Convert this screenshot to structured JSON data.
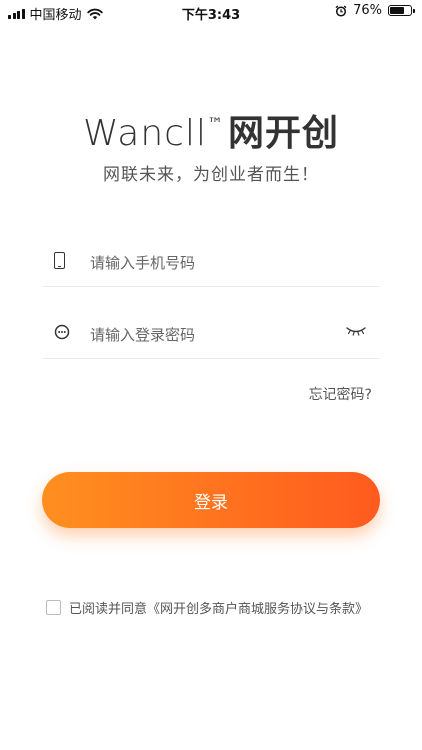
{
  "status_bar": {
    "carrier": "中国移动",
    "time": "下午3:43",
    "battery_percent": "76%",
    "battery_level": 0.76
  },
  "brand": {
    "latin": "Wancll",
    "tm": "™",
    "chinese": "网开创",
    "slogan": "网联未来，为创业者而生！"
  },
  "form": {
    "phone_placeholder": "请输入手机号码",
    "password_placeholder": "请输入登录密码",
    "forgot_label": "忘记密码?",
    "login_label": "登录"
  },
  "agreement": {
    "text": "已阅读并同意《网开创多商户商城服务协议与条款》"
  },
  "colors": {
    "button_start": "#ff8f1f",
    "button_end": "#ff5a1f"
  }
}
